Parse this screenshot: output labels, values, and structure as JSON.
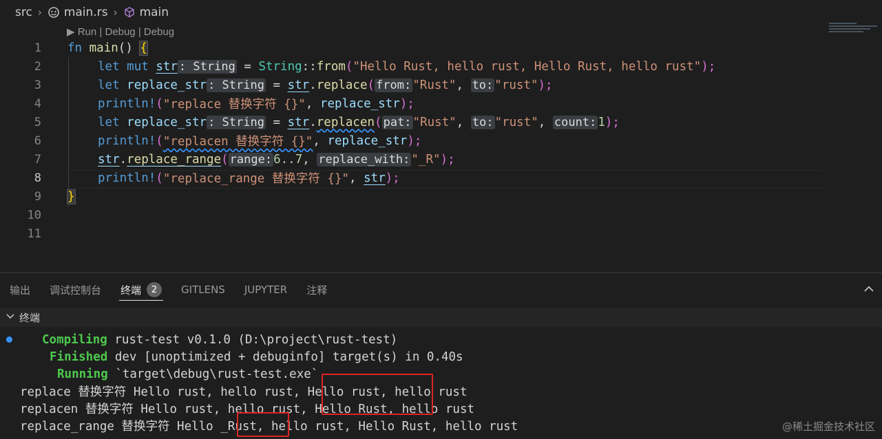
{
  "breadcrumb": {
    "segments": [
      "src",
      "main.rs",
      "main"
    ]
  },
  "codelens": "▶ Run | Debug | Debug",
  "editor": {
    "line_numbers": [
      "1",
      "2",
      "3",
      "4",
      "5",
      "6",
      "7",
      "8",
      "9",
      "10",
      "11"
    ],
    "active_line": "8",
    "lines": {
      "l1": [
        "fn",
        "main",
        "()",
        "{"
      ],
      "l2": [
        "let",
        "mut",
        "str",
        ": String",
        "=",
        "String",
        "::",
        "from",
        "(",
        "\"Hello Rust, hello rust, Hello Rust, hello rust\"",
        ");"
      ],
      "l3": [
        "let",
        "replace_str",
        ": String",
        "=",
        "str",
        ".",
        "replace",
        "(",
        "from:",
        "\"Rust\"",
        ",",
        "to:",
        "\"rust\"",
        ");"
      ],
      "l4": [
        "println!",
        "(",
        "\"replace 替换字符 {}\"",
        ",",
        "replace_str",
        ");"
      ],
      "l5": [
        "let",
        "replace_str",
        ": String",
        "=",
        "str",
        ".",
        "replacen",
        "(",
        "pat:",
        "\"Rust\"",
        ",",
        "to:",
        "\"rust\"",
        ",",
        "count:",
        "1",
        ");"
      ],
      "l6": [
        "println!",
        "(",
        "\"replacen 替换字符 {}\"",
        ",",
        "replace_str",
        ");"
      ],
      "l7": [
        "str",
        ".",
        "replace_range",
        "(",
        "range:",
        "6..7",
        ",",
        "replace_with:",
        "\"_R\"",
        ");"
      ],
      "l8": [
        "println!",
        "(",
        "\"replace_range 替换字符 {}\"",
        ",",
        "str",
        ");"
      ],
      "l9": [
        "}"
      ]
    }
  },
  "panel": {
    "tabs": [
      "输出",
      "调试控制台",
      "终端",
      "GITLENS",
      "JUPYTER",
      "注释"
    ],
    "active_tab": "终端",
    "terminal_badge": "2",
    "section_title": "终端"
  },
  "terminal": {
    "compiling_label": "Compiling",
    "compiling_text": "rust-test v0.1.0 (D:\\project\\rust-test)",
    "finished_label": "Finished",
    "finished_text": "dev [unoptimized + debuginfo] target(s) in 0.40s",
    "running_label": "Running",
    "running_text": "`target\\debug\\rust-test.exe`",
    "out1": "replace 替换字符 Hello rust, hello rust, Hello rust, hello rust",
    "out2": "replacen 替换字符 Hello rust, hello rust, Hello Rust, hello rust",
    "out3": "replace_range 替换字符 Hello _Rust, hello rust, Hello Rust, hello rust"
  },
  "watermark": "@稀土掘金技术社区",
  "colors": {
    "background": "#1e1e1e",
    "keyword": "#569cd6",
    "function": "#dcdcaa",
    "type": "#4ec9b0",
    "variable": "#9cdcfe",
    "string": "#ce9178",
    "highlight_box": "#e02424",
    "terminal_green": "#4ec94e"
  }
}
